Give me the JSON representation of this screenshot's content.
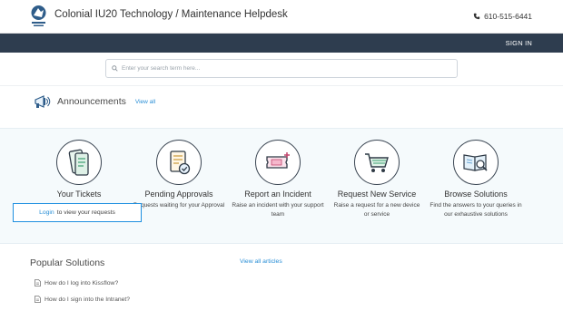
{
  "header": {
    "title": "Colonial IU20 Technology / Maintenance Helpdesk",
    "phone": "610-515-6441"
  },
  "nav": {
    "signin": "SIGN IN"
  },
  "search": {
    "placeholder": "Enter your search term here..."
  },
  "announcements": {
    "title": "Announcements",
    "view_all": "View all"
  },
  "cards": [
    {
      "title": "Your Tickets",
      "desc": ""
    },
    {
      "title": "Pending Approvals",
      "desc": "Requests waiting for your Approval"
    },
    {
      "title": "Report an Incident",
      "desc": "Raise an incident with your support team"
    },
    {
      "title": "Request New Service",
      "desc": "Raise a request for a new device or service"
    },
    {
      "title": "Browse Solutions",
      "desc": "Find the answers to your queries in our exhaustive solutions"
    }
  ],
  "login_prompt": {
    "link": "Login",
    "text": "to view your requests"
  },
  "popular": {
    "title": "Popular Solutions",
    "view_all": "View all articles",
    "articles": [
      "How do I log into Kissflow?",
      "How do I sign into the Intranet?"
    ]
  },
  "colors": {
    "navbar": "#2e3d4f",
    "link": "#2a8fd6",
    "accent_border": "#1e8fe0"
  }
}
